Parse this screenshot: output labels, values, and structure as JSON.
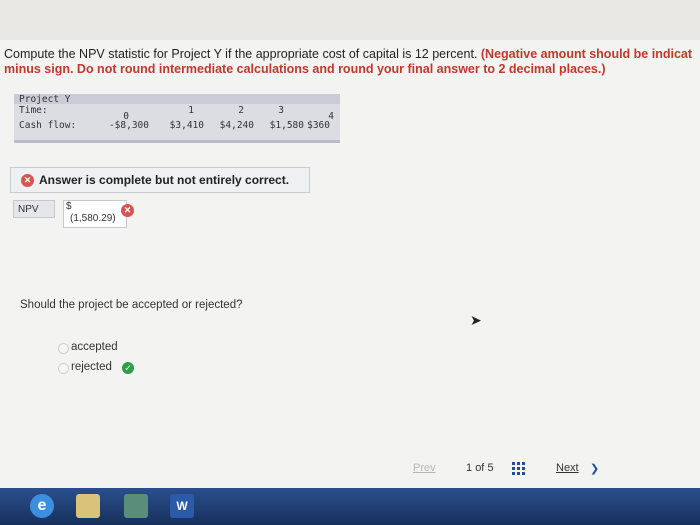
{
  "question": {
    "text": "Compute the NPV statistic for Project Y if the appropriate cost of capital is 12 percent.",
    "note_line1": "(Negative amount should be indicat",
    "note_line2": "minus sign. Do not round intermediate calculations and round your final answer to 2 decimal places.)"
  },
  "project": {
    "title": "Project Y",
    "time_label": "Time:",
    "cash_label": "Cash flow:",
    "times": [
      "0",
      "1",
      "2",
      "3",
      "4"
    ],
    "cash_flows": [
      "-$8,300",
      "$3,410",
      "$4,240",
      "$1,580",
      "$360"
    ]
  },
  "answer_banner": "Answer is complete but not entirely correct.",
  "npv": {
    "label": "NPV",
    "currency": "$",
    "value": "(1,580.29)"
  },
  "question2": "Should the project be accepted or rejected?",
  "options": [
    {
      "label": "accepted",
      "selected": false
    },
    {
      "label": "rejected",
      "selected": true
    }
  ],
  "nav": {
    "prev": "Prev",
    "page_current": "1",
    "page_of": "of",
    "page_total": "5",
    "next": "Next"
  },
  "colors": {
    "error": "#d9534f",
    "correct": "#2e9e4a",
    "note": "#c0392b",
    "taskbar": "#1f3e73"
  }
}
